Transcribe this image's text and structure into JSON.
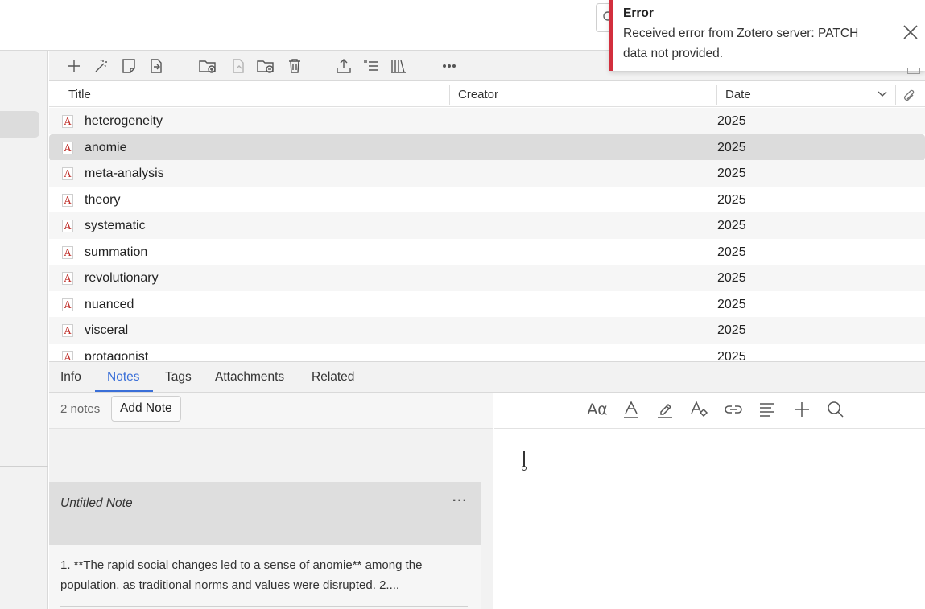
{
  "error": {
    "title": "Error",
    "message": "Received error from Zotero server: PATCH data not provided."
  },
  "toolbar": {
    "icons": [
      "new-item-icon",
      "magic-wand-icon",
      "new-note-icon",
      "add-attachment-icon",
      "new-collection-icon",
      "new-saved-search-icon",
      "remove-from-collection-icon",
      "trash-icon",
      "export-icon",
      "sort-list-icon",
      "library-icon",
      "more-icon"
    ]
  },
  "columns": {
    "title": "Title",
    "creator": "Creator",
    "date": "Date"
  },
  "items": [
    {
      "title": "heterogeneity",
      "date": "2025"
    },
    {
      "title": "anomie",
      "date": "2025"
    },
    {
      "title": "meta-analysis",
      "date": "2025"
    },
    {
      "title": "theory",
      "date": "2025"
    },
    {
      "title": "systematic",
      "date": "2025"
    },
    {
      "title": "summation",
      "date": "2025"
    },
    {
      "title": "revolutionary",
      "date": "2025"
    },
    {
      "title": "nuanced",
      "date": "2025"
    },
    {
      "title": "visceral",
      "date": "2025"
    },
    {
      "title": "protagonist",
      "date": "2025"
    }
  ],
  "item_icon_letter": "A",
  "selected_item_index": 1,
  "tabs": [
    {
      "label": "Info"
    },
    {
      "label": "Notes"
    },
    {
      "label": "Tags"
    },
    {
      "label": "Attachments"
    },
    {
      "label": "Related"
    }
  ],
  "active_tab": "Notes",
  "notes": {
    "count_label": "2 notes",
    "add_label": "Add Note",
    "list": [
      {
        "title": "Untitled Note",
        "menu": "···"
      },
      {
        "text": "1. **The rapid social changes led to a sense of anomie** among the population, as traditional norms and values were disrupted. 2...."
      }
    ]
  },
  "editor_toolbar": {
    "format_text_label": "Aα"
  },
  "colors": {
    "accent": "#3a6fd8",
    "error": "#d22f3d",
    "pdf_icon": "#c0302b",
    "selected_row": "#dcdcdc"
  }
}
